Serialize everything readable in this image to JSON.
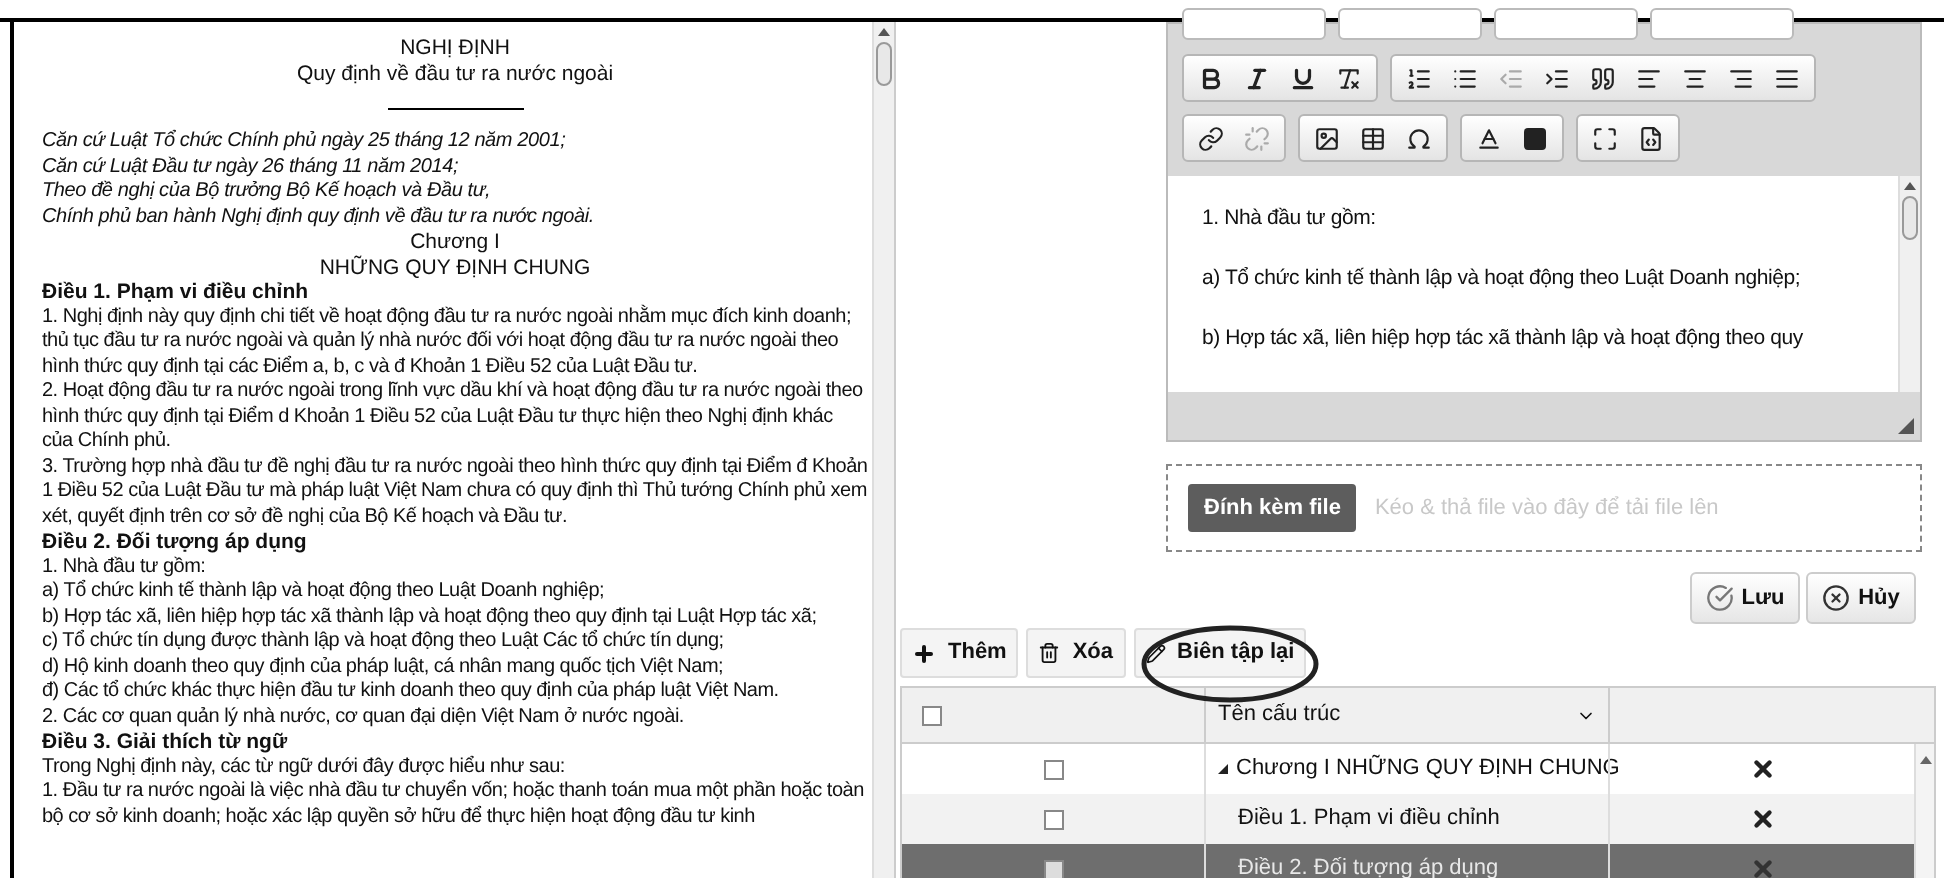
{
  "document": {
    "paragraphs": [
      {
        "kind": "title",
        "text": "NGHỊ ĐỊNH"
      },
      {
        "kind": "subtitle",
        "text": "Quy định về đầu tư ra nước ngoài"
      },
      {
        "kind": "rule"
      },
      {
        "kind": "italic",
        "text": "Căn cứ Luật Tổ chức Chính phủ ngày 25 tháng 12 năm 2001;"
      },
      {
        "kind": "italic",
        "text": "Căn cứ Luật Đầu tư ngày 26 tháng 11 năm 2014;"
      },
      {
        "kind": "italic",
        "text": "Theo đề nghị của Bộ trưởng Bộ Kế hoạch và Đầu tư,"
      },
      {
        "kind": "italic",
        "text": "Chính phủ ban hành Nghị định quy định về đầu tư ra nước ngoài."
      },
      {
        "kind": "chapter",
        "text": "Chương I"
      },
      {
        "kind": "chapter",
        "text": "NHỮNG QUY ĐỊNH CHUNG"
      },
      {
        "kind": "article",
        "text": "Điều 1. Phạm vi điều chỉnh"
      },
      {
        "kind": "text",
        "text": "1. Nghị định này quy định chi tiết về hoạt động đầu tư ra nước ngoài nhằm mục đích kinh doanh; thủ tục đầu tư ra nước ngoài và quản lý nhà nước đối với hoạt động đầu tư ra nước ngoài theo hình thức quy định tại các Điểm a, b, c và đ Khoản 1 Điều 52 của Luật Đầu tư."
      },
      {
        "kind": "text",
        "text": "2. Hoạt động đầu tư ra nước ngoài trong lĩnh vực dầu khí và hoạt động đầu tư ra nước ngoài theo hình thức quy định tại Điểm d Khoản 1 Điều 52 của Luật Đầu tư thực hiện theo Nghị định khác của Chính phủ."
      },
      {
        "kind": "text",
        "text": "3. Trường hợp nhà đầu tư đề nghị đầu tư ra nước ngoài theo hình thức quy định tại Điểm đ Khoản 1 Điều 52 của Luật Đầu tư mà pháp luật Việt Nam chưa có quy định thì Thủ tướng Chính phủ xem xét, quyết định trên cơ sở đề nghị của Bộ Kế hoạch và Đầu tư."
      },
      {
        "kind": "article",
        "text": "Điều 2. Đối tượng áp dụng"
      },
      {
        "kind": "text",
        "text": "1. Nhà đầu tư gồm:"
      },
      {
        "kind": "text",
        "text": "a) Tổ chức kinh tế thành lập và hoạt động theo Luật Doanh nghiệp;"
      },
      {
        "kind": "text",
        "text": "b) Hợp tác xã, liên hiệp hợp tác xã thành lập và hoạt động theo quy định tại Luật Hợp tác xã;"
      },
      {
        "kind": "text",
        "text": "c) Tổ chức tín dụng được thành lập và hoạt động theo Luật Các tổ chức tín dụng;"
      },
      {
        "kind": "text",
        "text": "d) Hộ kinh doanh theo quy định của pháp luật, cá nhân mang quốc tịch Việt Nam;"
      },
      {
        "kind": "text",
        "text": "đ) Các tổ chức khác thực hiện đầu tư kinh doanh theo quy định của pháp luật Việt Nam."
      },
      {
        "kind": "text",
        "text": "2. Các cơ quan quản lý nhà nước, cơ quan đại diện Việt Nam ở nước ngoài."
      },
      {
        "kind": "article",
        "text": "Điều 3. Giải thích từ ngữ"
      },
      {
        "kind": "text",
        "text": "Trong Nghị định này, các từ ngữ dưới đây được hiểu như sau:"
      },
      {
        "kind": "text",
        "text": "1. Đầu tư ra nước ngoài là việc nhà đầu tư chuyển vốn; hoặc thanh toán mua một phần hoặc toàn bộ cơ sở kinh doanh; hoặc xác lập quyền sở hữu để thực hiện hoạt động đầu tư kinh"
      }
    ]
  },
  "editor": {
    "paragraphs": [
      "1. Nhà đầu tư gồm:",
      "a) Tổ chức kinh tế thành lập và hoạt động theo Luật Doanh nghiệp;",
      "b) Hợp tác xã, liên hiệp hợp tác xã thành lập và hoạt động theo quy"
    ]
  },
  "attachment": {
    "button": "Đính kèm file",
    "placeholder": "Kéo & thả file vào đây để tải file lên"
  },
  "form_buttons": [
    {
      "kind": "save",
      "label": "Lưu"
    },
    {
      "kind": "cancel",
      "label": "Hủy"
    }
  ],
  "toolbar": [
    {
      "kind": "add",
      "label": "Thêm"
    },
    {
      "kind": "delete",
      "label": "Xóa"
    },
    {
      "kind": "edit",
      "label": "Biên tập lại"
    }
  ],
  "table": {
    "header_checked": false,
    "column": "Tên cấu trúc",
    "rows": [
      {
        "label": "Chương I NHỮNG QUY ĐỊNH CHUNG",
        "checked": false,
        "selected": false,
        "expanded": true,
        "children": [
          {
            "label": "Điều 1. Phạm vi điều chỉnh",
            "checked": false,
            "selected": false
          },
          {
            "label": "Điều 2. Đối tượng áp dụng",
            "checked": false,
            "selected": true
          }
        ]
      }
    ]
  }
}
